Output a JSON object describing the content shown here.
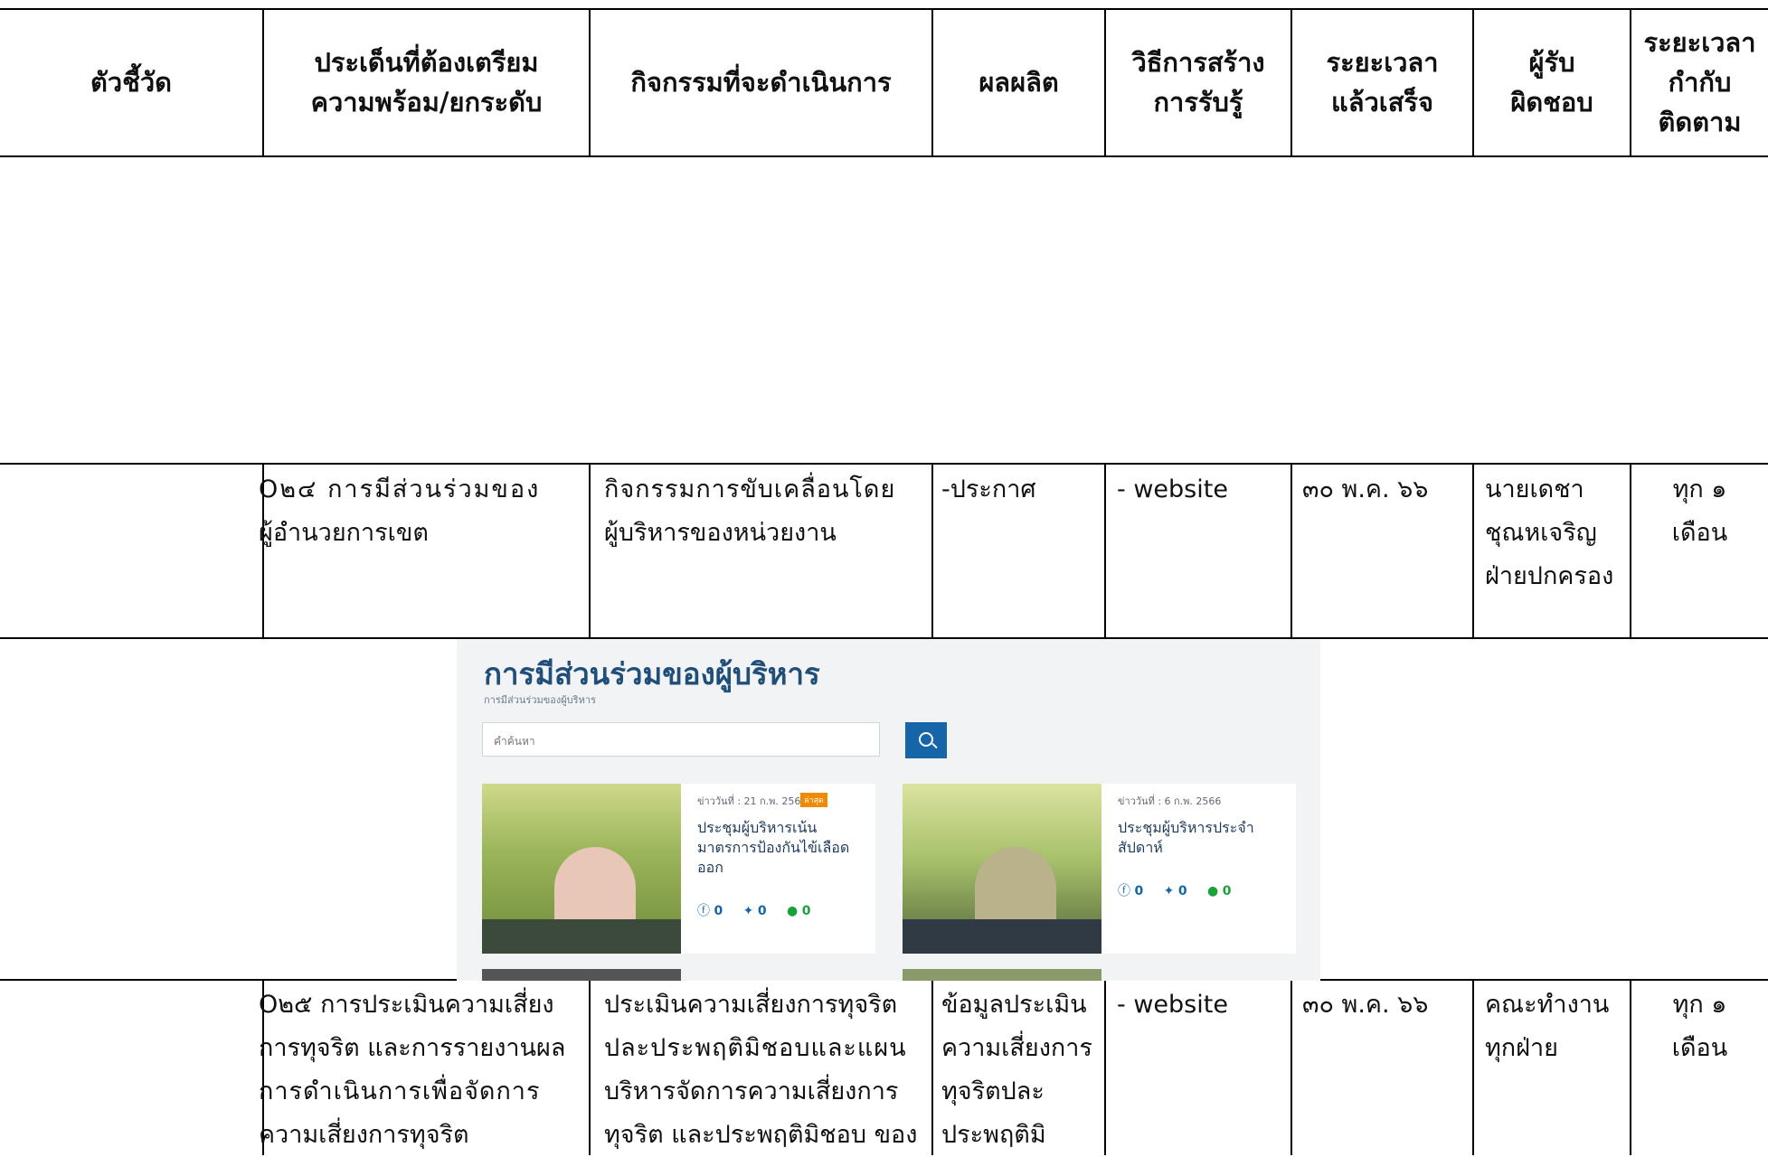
{
  "headers": {
    "indicator": "ตัวชี้วัด",
    "issue_line1": "ประเด็นที่ต้องเตรียม",
    "issue_line2": "ความพร้อม/ยกระดับ",
    "activity": "กิจกรรมที่จะดำเนินการ",
    "output": "ผลผลิต",
    "method_line1": "วิธีการสร้าง",
    "method_line2": "การรับรู้",
    "duration_line1": "ระยะเวลา",
    "duration_line2": "แล้วเสร็จ",
    "responsible_line1": "ผู้รับ",
    "responsible_line2": "ผิดชอบ",
    "monitor_line1": "ระยะเวลา",
    "monitor_line2": "กำกับ",
    "monitor_line3": "ติดตาม"
  },
  "row1": {
    "issue_line1": "O๒๔ การมีส่วนร่วมของ",
    "issue_line2": "ผู้อำนวยการเขต",
    "activity_line1": "กิจกรรมการขับเคลื่อนโดย",
    "activity_line2": "ผู้บริหารของหน่วยงาน",
    "output": "-ประกาศ",
    "method": "- website",
    "duration": "๓๐ พ.ค. ๖๖",
    "responsible_line1": "นายเดชา",
    "responsible_line2": "ชุณหเจริญ",
    "responsible_line3": "ฝ่ายปกครอง",
    "monitor_line1": "ทุก ๑",
    "monitor_line2": "เดือน"
  },
  "screenshot": {
    "title": "การมีส่วนร่วมของผู้บริหาร",
    "subtitle": "การมีส่วนร่วมของผู้บริหาร",
    "search_placeholder": "คำค้นหา",
    "cards": [
      {
        "date": "ข่าววันที่ : 21 ก.พ. 2566",
        "badge": "ล่าสุด",
        "title": "ประชุมผู้บริหารเน้นมาตรการป้องกันไข้เลือดออก",
        "likes": "0",
        "tweets": "0",
        "lines": "0"
      },
      {
        "date": "ข่าววันที่ : 6 ก.พ. 2566",
        "title": "ประชุมผู้บริหารประจำสัปดาห์",
        "likes": "0",
        "tweets": "0",
        "lines": "0"
      }
    ]
  },
  "row2": {
    "issue_line1": "O๒๕ การประเมินความเสี่ยง",
    "issue_line2": "การทุจริต และการรายงานผล",
    "issue_line3": "การดำเนินการเพื่อจัดการ",
    "issue_line4": "ความเสี่ยงการทุจริต",
    "activity_line1": "ประเมินความเสี่ยงการทุจริต",
    "activity_line2": "ปละประพฤติมิชอบและแผน",
    "activity_line3": "บริหารจัดการความเสี่ยงการ",
    "activity_line4": "ทุจริต และประพฤติมิชอบ ของ",
    "output_line1": "ข้อมูลประเมิน",
    "output_line2": "ความเสี่ยงการ",
    "output_line3": "ทุจริตปละ",
    "output_line4": "ประพฤติมิ",
    "method": "- website",
    "duration": "๓๐ พ.ค. ๖๖",
    "responsible_line1": "คณะทำงาน",
    "responsible_line2": "ทุกฝ่าย",
    "monitor_line1": "ทุก ๑",
    "monitor_line2": "เดือน"
  }
}
